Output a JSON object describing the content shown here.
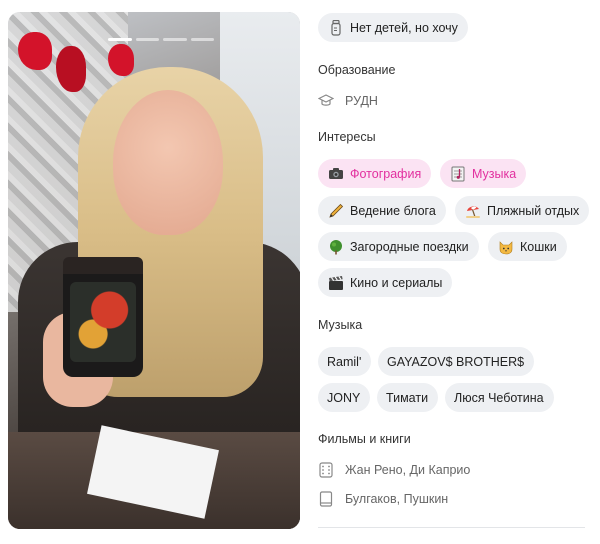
{
  "photo": {
    "pages": 4,
    "current": 1
  },
  "children": {
    "label": "Нет детей, но хочу",
    "icon": "bottle-icon"
  },
  "education": {
    "title": "Образование",
    "value": "РУДН",
    "icon": "graduation-cap-icon"
  },
  "interests": {
    "title": "Интересы",
    "items": [
      {
        "label": "Фотография",
        "icon": "camera-icon",
        "highlight": true
      },
      {
        "label": "Музыка",
        "icon": "music-note-icon",
        "highlight": true
      },
      {
        "label": "Ведение блога",
        "icon": "pen-icon",
        "highlight": false
      },
      {
        "label": "Пляжный отдых",
        "icon": "beach-umbrella-icon",
        "highlight": false
      },
      {
        "label": "Загородные поездки",
        "icon": "tree-icon",
        "highlight": false
      },
      {
        "label": "Кошки",
        "icon": "cat-icon",
        "highlight": false
      },
      {
        "label": "Кино и сериалы",
        "icon": "clapperboard-icon",
        "highlight": false
      }
    ]
  },
  "music": {
    "title": "Музыка",
    "items": [
      "Ramil'",
      "GAYAZOV$ BROTHER$",
      "JONY",
      "Тимати",
      "Люся Чеботина"
    ]
  },
  "films_books": {
    "title": "Фильмы и книги",
    "films": "Жан Рено, Ди Каприо",
    "books": "Булгаков, Пушкин"
  },
  "colors": {
    "highlight_bg": "#fbe3f3",
    "highlight_text": "#e2309f",
    "chip_bg": "#eef0f3"
  }
}
